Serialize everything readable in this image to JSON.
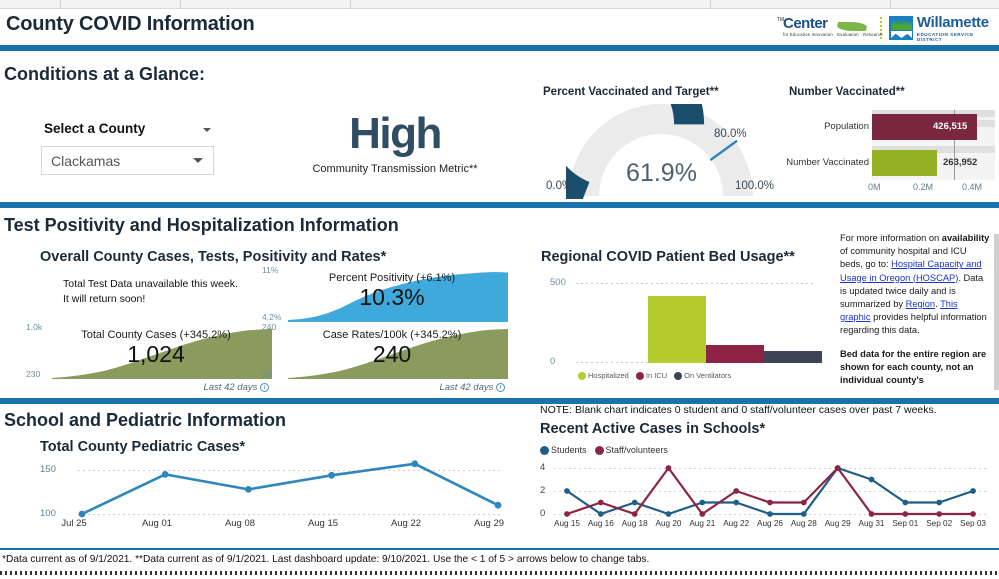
{
  "header": {
    "title": "County COVID Information",
    "logo_center": {
      "tm": "TM",
      "word": "Center",
      "sub": "for Education Innovation · Evaluation · Research"
    },
    "logo_wesd": {
      "word": "Willamette",
      "sub": "EDUCATION SERVICE DISTRICT"
    }
  },
  "sections": {
    "conditions": "Conditions at a Glance:",
    "positivity": "Test Positivity and Hospitalization Information",
    "school": "School and Pediatric Information"
  },
  "county_select": {
    "label": "Select a County",
    "value": "Clackamas",
    "placeholder": "Clackamas"
  },
  "transmission": {
    "level": "High",
    "caption": "Community Transmission Metric**"
  },
  "gauge": {
    "title": "Percent Vaccinated and Target**",
    "value_label": "61.9%",
    "min_label": "0.0%",
    "max_label": "100.0%",
    "target_label": "80.0%",
    "value": 61.9,
    "target": 80.0,
    "min": 0,
    "max": 100,
    "fill_color": "#1b4e6b",
    "track_color": "#ebebeb"
  },
  "number_vaccinated": {
    "title": "Number Vaccinated**",
    "rows": [
      {
        "label": "Population",
        "value_label": "426,515",
        "value": 426515,
        "color": "#7c2742"
      },
      {
        "label": "Number Vaccinated",
        "value_label": "263,952",
        "value": 263952,
        "color": "#93b125"
      }
    ],
    "ticks": [
      "0M",
      "0.2M",
      "0.4M"
    ],
    "axis_max": 500000
  },
  "overall": {
    "title": "Overall County Cases, Tests, Positivity and Rates*",
    "unavailable_line1": "Total Test Data unavailable this week.",
    "unavailable_line2": "It will return soon!",
    "footnote": "Last 42 days"
  },
  "mini_charts": [
    {
      "id": "percent-positivity",
      "title": "Percent Positivity (+6.1%)",
      "big_value": "10.3%",
      "axis_top": "11%",
      "axis_bottom": "4.2%",
      "color": "#3fa9dc",
      "points": [
        0.04,
        0.06,
        0.1,
        0.17,
        0.27,
        0.4,
        0.52,
        0.62,
        0.7,
        0.77,
        0.83,
        0.88,
        0.92,
        0.95,
        0.97,
        0.99,
        1.0,
        0.99
      ]
    },
    {
      "id": "total-county-cases",
      "title": "Total County Cases (+345.2%)",
      "big_value": "1,024",
      "axis_top": "1.0k",
      "axis_bottom": "230",
      "color": "#8b9b5e",
      "points": [
        0.02,
        0.04,
        0.07,
        0.11,
        0.16,
        0.23,
        0.31,
        0.4,
        0.49,
        0.58,
        0.67,
        0.75,
        0.82,
        0.88,
        0.93,
        0.97,
        0.99,
        1.0
      ]
    },
    {
      "id": "case-rates-100k",
      "title": "Case Rates/100k (+345.2%)",
      "big_value": "240",
      "axis_top": "240",
      "axis_bottom": "54",
      "color": "#8b9b5e",
      "points": [
        0.02,
        0.04,
        0.07,
        0.11,
        0.16,
        0.23,
        0.31,
        0.4,
        0.49,
        0.58,
        0.67,
        0.75,
        0.82,
        0.88,
        0.93,
        0.97,
        0.99,
        1.0
      ]
    }
  ],
  "bed_usage": {
    "title": "Regional COVID Patient Bed Usage**",
    "y_ticks": [
      "500",
      "0"
    ],
    "y_max": 500,
    "bars": [
      {
        "label": "Hospitalized",
        "value": 420,
        "color": "#b5cc2e"
      },
      {
        "label": "In ICU",
        "value": 112,
        "color": "#8e2445"
      },
      {
        "label": "On Ventilators",
        "value": 75,
        "color": "#3d4552"
      }
    ]
  },
  "side_info": {
    "p1_a": "For more information on ",
    "p1_b": "availability",
    "p1_c": " of community hospital and ICU beds, go to: ",
    "link1": "Hospital Capacity and Usage in Oregon (HOSCAP)",
    "p1_d": ". Data is updated twice daily and is summarized by ",
    "link2": "Region",
    "p1_e": ". ",
    "link3": "This graphic",
    "p1_f": " provides helpful information regarding this data.",
    "p2": "Bed data for the entire region are shown for each county, not an individual county's"
  },
  "pediatric": {
    "title": "Total County Pediatric Cases*",
    "y_ticks": [
      "150",
      "100"
    ],
    "y_min": 90,
    "y_max": 165,
    "color": "#2e86bd",
    "categories": [
      "Jul 25",
      "Aug 01",
      "Aug 08",
      "Aug 15",
      "Aug 22",
      "Aug 29"
    ],
    "values": [
      100,
      145,
      128,
      144,
      157,
      110
    ]
  },
  "schools": {
    "note": "NOTE: Blank chart indicates 0 student and 0 staff/volunteer cases over past 7 weeks.",
    "title": "Recent Active Cases in Schools*",
    "legend": [
      {
        "label": "Students",
        "color": "#1f5e86"
      },
      {
        "label": "Staff/volunteers",
        "color": "#8e2445"
      }
    ],
    "y_ticks": [
      "4",
      "2",
      "0"
    ],
    "y_max": 4,
    "categories": [
      "Aug 15",
      "Aug 16",
      "Aug 18",
      "Aug 20",
      "Aug 21",
      "Aug 22",
      "Aug 26",
      "Aug 28",
      "Aug 29",
      "Aug 31",
      "Sep 01",
      "Sep 02",
      "Sep 03"
    ],
    "series": [
      {
        "name": "Students",
        "color": "#1f5e86",
        "values": [
          2,
          0,
          1,
          0,
          1,
          1,
          0,
          0,
          4,
          3,
          1,
          1,
          2
        ]
      },
      {
        "name": "Staff/volunteers",
        "color": "#8e2445",
        "values": [
          0,
          1,
          0,
          4,
          0,
          2,
          1,
          1,
          4,
          0,
          0,
          0,
          0
        ]
      }
    ]
  },
  "footer": {
    "text": "*Data current as of 9/1/2021. **Data current as of 9/1/2021. Last dashboard update: 9/10/2021. Use the < 1 of 5 > arrows below to change tabs."
  },
  "chart_data": [
    {
      "type": "line",
      "title": "Total County Pediatric Cases*",
      "categories": [
        "Jul 25",
        "Aug 01",
        "Aug 08",
        "Aug 15",
        "Aug 22",
        "Aug 29"
      ],
      "values": [
        100,
        145,
        128,
        144,
        157,
        110
      ],
      "xlabel": "",
      "ylabel": "",
      "ylim": [
        90,
        165
      ],
      "grid": true,
      "legend": "none"
    },
    {
      "type": "line",
      "title": "Recent Active Cases in Schools*",
      "categories": [
        "Aug 15",
        "Aug 16",
        "Aug 18",
        "Aug 20",
        "Aug 21",
        "Aug 22",
        "Aug 26",
        "Aug 28",
        "Aug 29",
        "Aug 31",
        "Sep 01",
        "Sep 02",
        "Sep 03"
      ],
      "series": [
        {
          "name": "Students",
          "values": [
            2,
            0,
            1,
            0,
            1,
            1,
            0,
            0,
            4,
            3,
            1,
            1,
            2
          ]
        },
        {
          "name": "Staff/volunteers",
          "values": [
            0,
            1,
            0,
            4,
            0,
            2,
            1,
            1,
            4,
            0,
            0,
            0,
            0
          ]
        }
      ],
      "xlabel": "",
      "ylabel": "",
      "ylim": [
        0,
        4
      ],
      "grid": true,
      "legend": "top-left"
    },
    {
      "type": "bar",
      "title": "Regional COVID Patient Bed Usage**",
      "categories": [
        "Hospitalized",
        "In ICU",
        "On Ventilators"
      ],
      "values": [
        420,
        112,
        75
      ],
      "xlabel": "",
      "ylabel": "",
      "ylim": [
        0,
        500
      ],
      "grid": true,
      "legend": "bottom"
    },
    {
      "type": "bar",
      "title": "Number Vaccinated**",
      "categories": [
        "Population",
        "Number Vaccinated"
      ],
      "values": [
        426515,
        263952
      ],
      "xlabel": "",
      "ylabel": "",
      "ylim": [
        0,
        500000
      ],
      "grid": false,
      "legend": "none"
    },
    {
      "type": "pie",
      "title": "Percent Vaccinated and Target**",
      "categories": [
        "Vaccinated",
        "Remaining"
      ],
      "values": [
        61.9,
        38.1
      ],
      "annotations": [
        "target 80.0%"
      ],
      "ylim": [
        0,
        100
      ],
      "legend": "none"
    },
    {
      "type": "area",
      "title": "Percent Positivity (+6.1%)",
      "values": [
        4.2,
        4.6,
        5.0,
        5.6,
        6.2,
        6.9,
        7.5,
        8.1,
        8.6,
        9.0,
        9.4,
        9.7,
        10.0,
        10.2,
        10.4,
        10.6,
        10.7,
        10.3
      ],
      "ylim": [
        4.2,
        11
      ],
      "legend": "none"
    },
    {
      "type": "area",
      "title": "Total County Cases (+345.2%)",
      "values": [
        245,
        260,
        285,
        315,
        355,
        405,
        470,
        540,
        610,
        680,
        745,
        805,
        860,
        905,
        945,
        975,
        995,
        1024
      ],
      "ylim": [
        230,
        1000
      ],
      "legend": "none"
    },
    {
      "type": "area",
      "title": "Case Rates/100k (+345.2%)",
      "values": [
        58,
        61,
        67,
        74,
        84,
        95,
        110,
        127,
        143,
        160,
        175,
        189,
        202,
        212,
        221,
        228,
        234,
        240
      ],
      "ylim": [
        54,
        240
      ],
      "legend": "none"
    }
  ]
}
